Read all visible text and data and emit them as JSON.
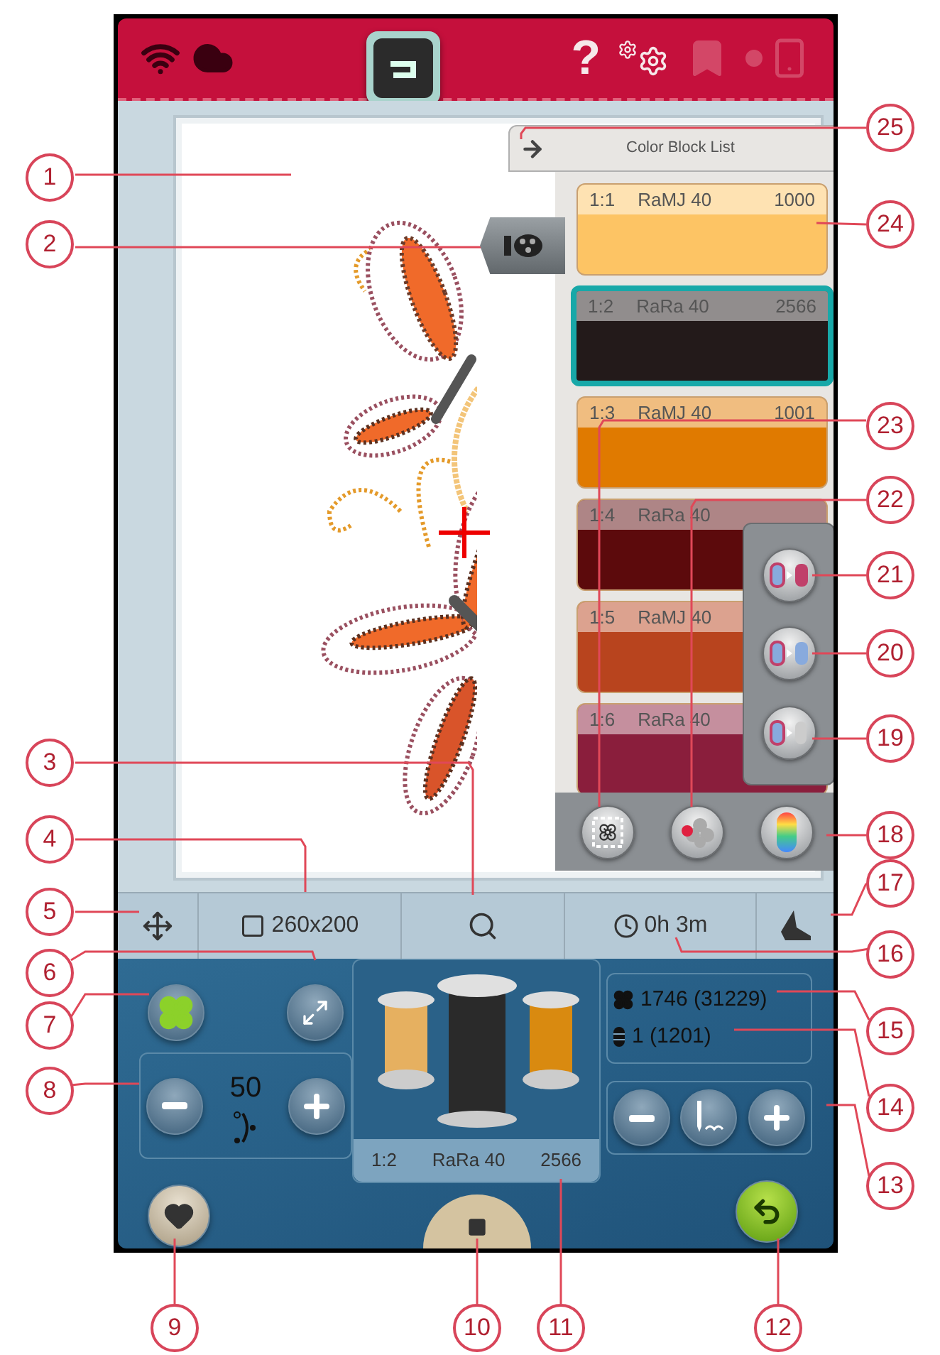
{
  "top_bar": {
    "buttons": [
      {
        "kind": "help",
        "label": "?",
        "disabled": false
      },
      {
        "kind": "settings",
        "disabled": false
      },
      {
        "kind": "save",
        "disabled": true
      },
      {
        "kind": "device",
        "disabled": true
      }
    ]
  },
  "color_block_list": {
    "title": "Color Block List",
    "blocks": [
      {
        "index": "1:1",
        "thread": "RaMJ 40",
        "number": "1000",
        "color": "#fdc464",
        "selected": false
      },
      {
        "index": "1:2",
        "thread": "RaRa 40",
        "number": "2566",
        "color": "#231a1a",
        "selected": true
      },
      {
        "index": "1:3",
        "thread": "RaMJ 40",
        "number": "1001",
        "color": "#e07a00",
        "selected": false
      },
      {
        "index": "1:4",
        "thread": "RaRa 40",
        "color": "#5c0a0c",
        "selected": false
      },
      {
        "index": "1:5",
        "thread": "RaMJ 40",
        "color": "#b8441e",
        "selected": false
      },
      {
        "index": "1:6",
        "thread": "RaRa 40",
        "color": "#8a1e3c",
        "selected": false
      }
    ]
  },
  "status_bar": {
    "hoop_size": "260x200",
    "time": "0h 3m"
  },
  "stitch_controls": {
    "value": "50"
  },
  "thread": {
    "index": "1:2",
    "name": "RaRa 40",
    "number": "2566"
  },
  "counts": {
    "stitches": "1746 (31229)",
    "blocks": "1 (1201)"
  },
  "left_callouts": [
    "1",
    "2",
    "3",
    "4",
    "5",
    "6",
    "7",
    "8"
  ],
  "bottom_callouts": [
    "9",
    "10",
    "11",
    "12"
  ],
  "right_callouts": [
    "25",
    "24",
    "23",
    "22",
    "21",
    "20",
    "19",
    "18",
    "17",
    "16",
    "15",
    "14",
    "13"
  ]
}
